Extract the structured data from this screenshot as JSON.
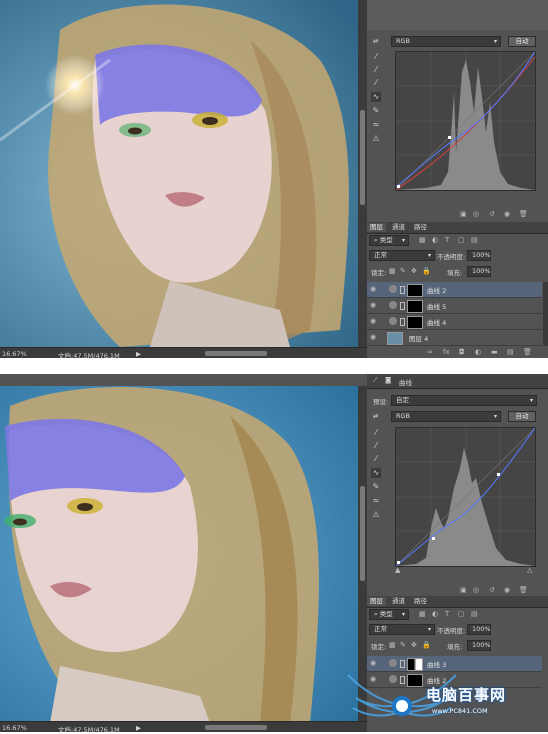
{
  "top": {
    "channel": "RGB",
    "auto_button": "自动",
    "layer_tabs": [
      "图层",
      "通道",
      "路径"
    ],
    "filter_kind": "类型",
    "blend_mode": "正常",
    "opacity_label": "不透明度:",
    "opacity_value": "100%",
    "lock_label": "锁定:",
    "fill_label": "填充:",
    "fill_value": "100%",
    "layers": [
      {
        "name": "曲线 2",
        "selected": true
      },
      {
        "name": "曲线 5",
        "selected": false
      },
      {
        "name": "曲线 4",
        "selected": false
      },
      {
        "name": "图层 4",
        "selected": false
      }
    ],
    "status_zoom": "16.67%",
    "status_doc": "文档:47.5M/476.1M"
  },
  "bottom": {
    "properties_title": "曲线",
    "preset_label": "预设:",
    "preset_value": "自定",
    "channel": "RGB",
    "auto_button": "自动",
    "layer_tabs": [
      "图层",
      "通道",
      "路径"
    ],
    "filter_kind": "类型",
    "blend_mode": "正常",
    "opacity_label": "不透明度:",
    "opacity_value": "100%",
    "lock_label": "锁定:",
    "fill_label": "填充:",
    "fill_value": "100%",
    "layers": [
      {
        "name": "曲线 3",
        "selected": true
      },
      {
        "name": "曲线 2",
        "selected": false
      }
    ],
    "status_zoom": "16.67%",
    "status_doc": "文档:47.5M/476.1M"
  },
  "watermark": {
    "text": "电脑百事网",
    "url": "www.PC841.COM"
  },
  "colors": {
    "panel_bg": "#535353",
    "selected_layer": "#56657a",
    "canvas_blue": "#3d7fa8",
    "histogram": "#8a8a8a",
    "curve_blue": "#5a78ff",
    "curve_red": "#d04040"
  }
}
